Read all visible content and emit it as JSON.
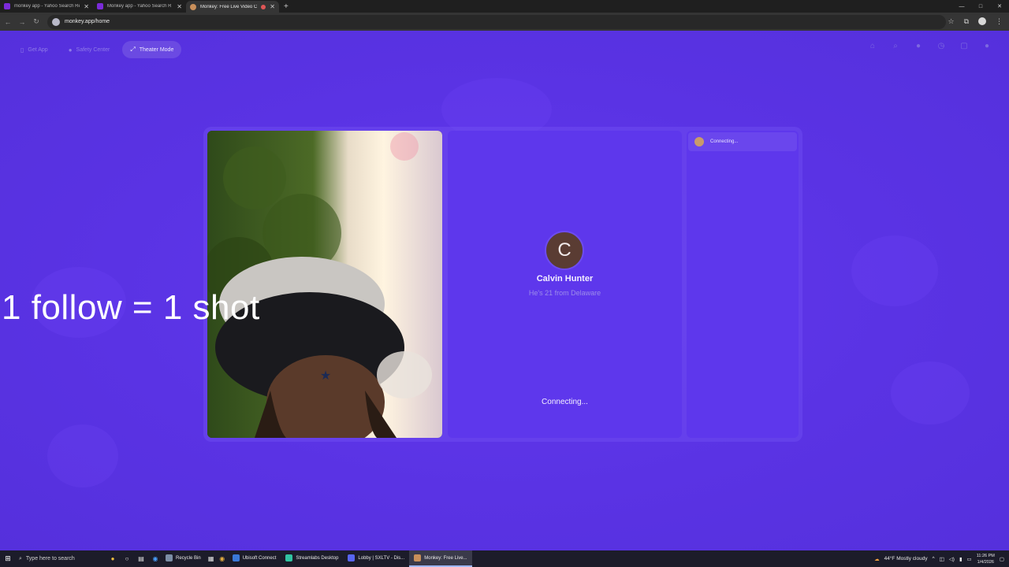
{
  "browser": {
    "tabs": [
      {
        "title": "monkey app - Yahoo Search Re",
        "active": false
      },
      {
        "title": "Monkey app - Yahoo Search R",
        "active": false
      },
      {
        "title": "Monkey: Free Live Video Ch",
        "active": true
      }
    ],
    "new_tab": "+",
    "window": {
      "minimize": "—",
      "maximize": "□",
      "close": "✕"
    },
    "url": "monkey.app/home"
  },
  "nav": {
    "items": [
      {
        "label": "Get App",
        "icon": "phone-icon"
      },
      {
        "label": "Safety Center",
        "icon": "shield-icon"
      },
      {
        "label": "Theater Mode",
        "icon": "expand-icon"
      }
    ]
  },
  "partner": {
    "initial": "C",
    "name": "Calvin Hunter",
    "info": "He's 21 from Delaware",
    "status": "Connecting..."
  },
  "side_panel": {
    "status": "Connecting..."
  },
  "overlay_text": "1 follow = 1 shot",
  "taskbar": {
    "search_placeholder": "Type here to search",
    "apps": [
      {
        "label": "Recycle Bin",
        "color": "#7c8ea6",
        "active": false
      },
      {
        "label": "Ubisoft Connect",
        "color": "#3a78d8",
        "active": false
      },
      {
        "label": "Streamlabs Desktop",
        "color": "#31c3a2",
        "active": false
      },
      {
        "label": "Lobby | SXLTV - Dis...",
        "color": "#5865f2",
        "active": false
      },
      {
        "label": "Monkey: Free Live...",
        "color": "#c98f5a",
        "active": true
      }
    ],
    "weather": "44°F  Mostly cloudy",
    "time": "11:26 PM",
    "date": "1/4/2026"
  }
}
